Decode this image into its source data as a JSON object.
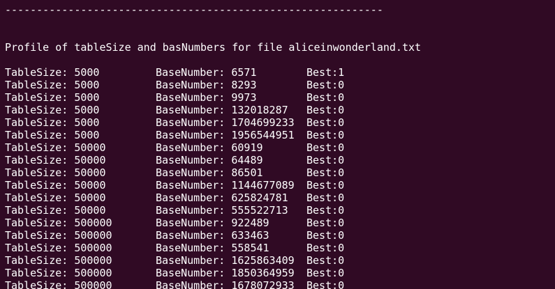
{
  "terminal": {
    "separator": "------------------------------------------------------------",
    "header": "Profile of tableSize and basNumbers for file aliceinwonderland.txt",
    "rows": [
      {
        "table_size": "TableSize: 5000",
        "base_number": "BaseNumber: 6571",
        "best": "Best:1"
      },
      {
        "table_size": "TableSize: 5000",
        "base_number": "BaseNumber: 8293",
        "best": "Best:0"
      },
      {
        "table_size": "TableSize: 5000",
        "base_number": "BaseNumber: 9973",
        "best": "Best:0"
      },
      {
        "table_size": "TableSize: 5000",
        "base_number": "BaseNumber: 132018287",
        "best": "Best:0"
      },
      {
        "table_size": "TableSize: 5000",
        "base_number": "BaseNumber: 1704699233",
        "best": "Best:0"
      },
      {
        "table_size": "TableSize: 5000",
        "base_number": "BaseNumber: 1956544951",
        "best": "Best:0"
      },
      {
        "table_size": "TableSize: 50000",
        "base_number": "BaseNumber: 60919",
        "best": "Best:0"
      },
      {
        "table_size": "TableSize: 50000",
        "base_number": "BaseNumber: 64489",
        "best": "Best:0"
      },
      {
        "table_size": "TableSize: 50000",
        "base_number": "BaseNumber: 86501",
        "best": "Best:0"
      },
      {
        "table_size": "TableSize: 50000",
        "base_number": "BaseNumber: 1144677089",
        "best": "Best:0"
      },
      {
        "table_size": "TableSize: 50000",
        "base_number": "BaseNumber: 625824781",
        "best": "Best:0"
      },
      {
        "table_size": "TableSize: 50000",
        "base_number": "BaseNumber: 555522713",
        "best": "Best:0"
      },
      {
        "table_size": "TableSize: 500000",
        "base_number": "BaseNumber: 922489",
        "best": "Best:0"
      },
      {
        "table_size": "TableSize: 500000",
        "base_number": "BaseNumber: 633463",
        "best": "Best:0"
      },
      {
        "table_size": "TableSize: 500000",
        "base_number": "BaseNumber: 558541",
        "best": "Best:0"
      },
      {
        "table_size": "TableSize: 500000",
        "base_number": "BaseNumber: 1625863409",
        "best": "Best:0"
      },
      {
        "table_size": "TableSize: 500000",
        "base_number": "BaseNumber: 1850364959",
        "best": "Best:0"
      },
      {
        "table_size": "TableSize: 500000",
        "base_number": "BaseNumber: 1678072933",
        "best": "Best:0"
      }
    ]
  },
  "colors": {
    "background": "#300a24",
    "foreground": "#ffffff"
  }
}
